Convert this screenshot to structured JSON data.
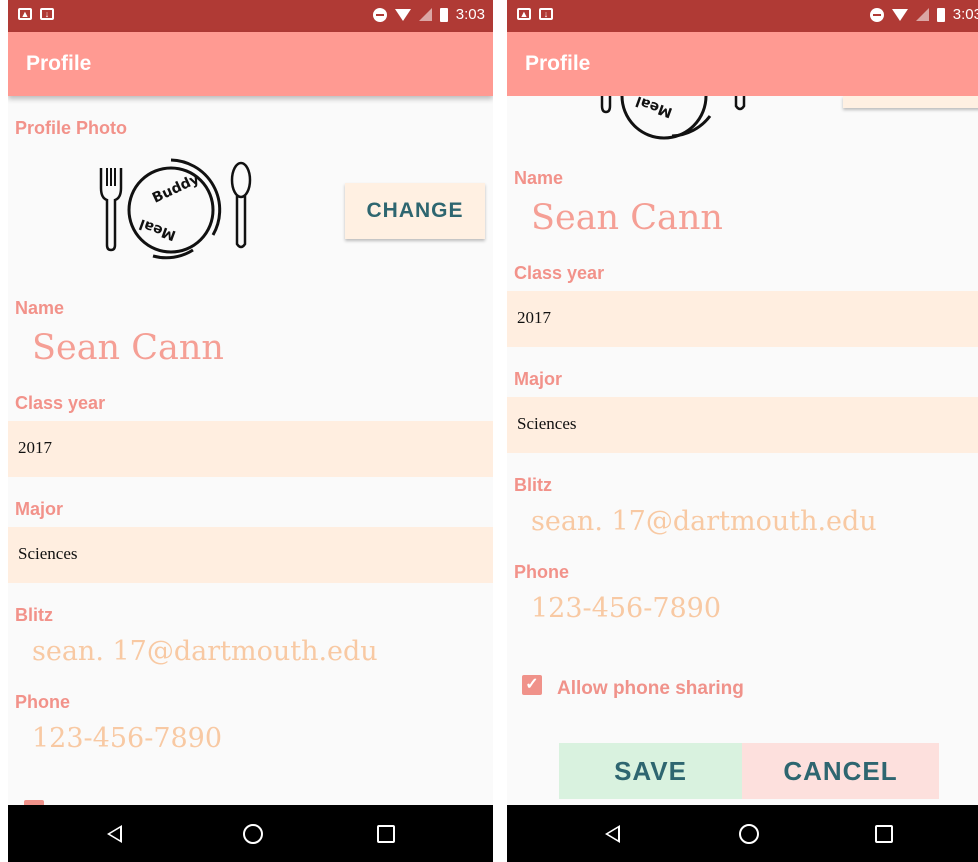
{
  "status_bar": {
    "time": "3:03"
  },
  "app_bar": {
    "title": "Profile"
  },
  "profile": {
    "photo_label": "Profile Photo",
    "change_label": "CHANGE",
    "logo_text_top": "Buddy",
    "logo_text_bottom": "Meal",
    "name_label": "Name",
    "name_value": "Sean Cann",
    "class_year_label": "Class year",
    "class_year_value": "2017",
    "major_label": "Major",
    "major_value": "Sciences",
    "blitz_label": "Blitz",
    "blitz_value": "sean. 17@dartmouth.edu",
    "phone_label": "Phone",
    "phone_value": "123-456-7890",
    "allow_phone_sharing_label": "Allow phone sharing",
    "allow_phone_sharing_checked": true
  },
  "actions": {
    "save_label": "SAVE",
    "cancel_label": "CANCEL"
  },
  "colors": {
    "status_bar": "#b03a35",
    "app_bar": "#ff9a92",
    "accent_text": "#f2928a",
    "field_bg": "#ffeee0",
    "button_text": "#2e6670",
    "save_bg": "#d9f2df",
    "cancel_bg": "#fde0dd"
  },
  "icons": [
    "gallery-icon",
    "download-icon",
    "do-not-disturb-icon",
    "wifi-icon",
    "no-signal-icon",
    "battery-icon",
    "back-icon",
    "home-icon",
    "recents-icon"
  ]
}
